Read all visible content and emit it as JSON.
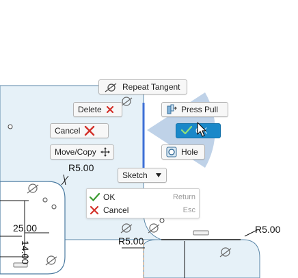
{
  "marking_menu": {
    "repeat_tangent": "Repeat Tangent",
    "delete": "Delete",
    "cancel": "Cancel",
    "move_copy": "Move/Copy",
    "press_pull": "Press Pull",
    "ok": "OK",
    "hole": "Hole",
    "sketch": "Sketch"
  },
  "context_menu": {
    "items": [
      {
        "label": "OK",
        "shortcut": "Return"
      },
      {
        "label": "Cancel",
        "shortcut": "Esc"
      }
    ]
  },
  "dimensions": {
    "radius_top_left": "R5.00",
    "radius_bottom_middle": "R5.00",
    "radius_right": "R5.00",
    "width": "25.00",
    "height": "14.00"
  },
  "colors": {
    "sketch_fill": "#e6f1f8",
    "sketch_edge": "#5b87a8",
    "selected_edge": "#3d6fd6",
    "ok_button": "#1a88c9",
    "check_green": "#3a9a2f",
    "cancel_red": "#d3312a"
  },
  "icons": [
    "tangent-constraint-icon",
    "delete-x-icon",
    "cancel-x-icon",
    "move-arrows-icon",
    "press-pull-icon",
    "checkmark-icon",
    "hole-icon",
    "dropdown-triangle-icon",
    "mouse-cursor-icon"
  ]
}
